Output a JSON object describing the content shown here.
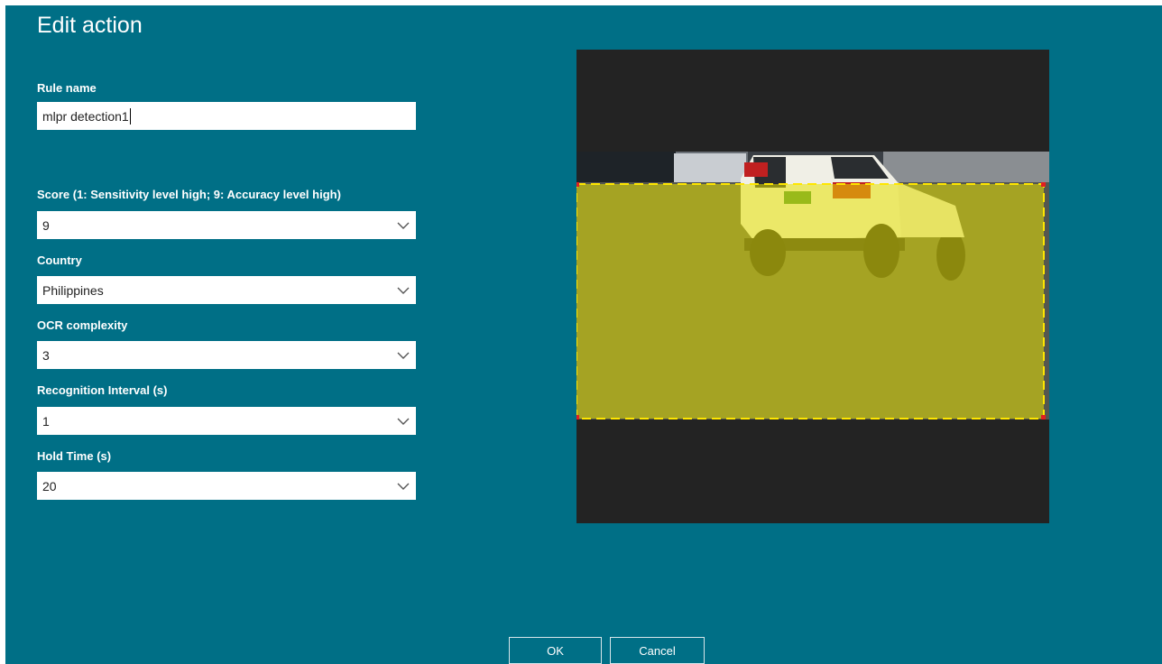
{
  "dialog": {
    "title": "Edit action"
  },
  "rule_name": {
    "label": "Rule name",
    "value": "mlpr detection1"
  },
  "fields": [
    {
      "label": "Score (1: Sensitivity level high; 9: Accuracy level high)",
      "value": "9"
    },
    {
      "label": "Country",
      "value": "Philippines"
    },
    {
      "label": "OCR complexity",
      "value": "3"
    },
    {
      "label": "Recognition Interval (s)",
      "value": "1"
    },
    {
      "label": "Hold Time (s)",
      "value": "20"
    }
  ],
  "icons": {
    "dropdown": "chevron-down-icon"
  },
  "colors": {
    "background": "#006f86",
    "detection_region_fill": "#e8e200",
    "detection_region_border": "#ffe600",
    "preview_background": "#232323"
  },
  "buttons": {
    "ok": "OK",
    "cancel": "Cancel"
  }
}
